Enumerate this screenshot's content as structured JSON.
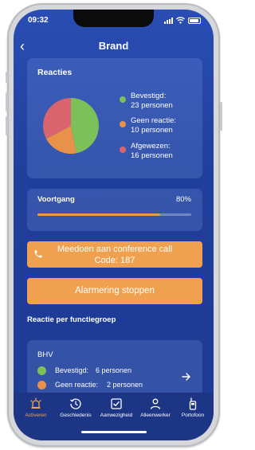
{
  "status_bar": {
    "time": "09:32"
  },
  "header": {
    "title": "Brand"
  },
  "reacties": {
    "title": "Reacties",
    "legend": [
      {
        "label": "Bevestigd:",
        "count": "23 personen",
        "color": "#7cc05a"
      },
      {
        "label": "Geen reactie:",
        "count": "10 personen",
        "color": "#e8914a"
      },
      {
        "label": "Afgewezen:",
        "count": "16 personen",
        "color": "#d9646e"
      }
    ]
  },
  "chart_data": {
    "type": "pie",
    "categories": [
      "Bevestigd",
      "Geen reactie",
      "Afgewezen"
    ],
    "values": [
      23,
      10,
      16
    ],
    "colors": [
      "#7cc05a",
      "#e8914a",
      "#d9646e"
    ]
  },
  "voortgang": {
    "title": "Voortgang",
    "percent_label": "80%",
    "fraction": 0.8
  },
  "conference": {
    "line1": "Meedoen aan conference call",
    "line2": "Code: 187"
  },
  "alarm_stop": {
    "label": "Alarmering stoppen"
  },
  "functiegroep": {
    "section_title": "Reactie per functiegroep",
    "group_name": "BHV",
    "rows": [
      {
        "label": "Bevestigd:",
        "count": "6 personen",
        "color": "#7cc05a"
      },
      {
        "label": "Geen reactie:",
        "count": "2 personen",
        "color": "#e8914a"
      }
    ]
  },
  "tabs": [
    {
      "label": "Activeren",
      "icon": "alarm-light-icon",
      "active": true
    },
    {
      "label": "Geschiedenis",
      "icon": "history-icon",
      "active": false
    },
    {
      "label": "Aanwezigheid",
      "icon": "checkbox-icon",
      "active": false
    },
    {
      "label": "Alleenwerker",
      "icon": "person-icon",
      "active": false
    },
    {
      "label": "Portofoon",
      "icon": "walkie-talkie-icon",
      "active": false
    }
  ]
}
